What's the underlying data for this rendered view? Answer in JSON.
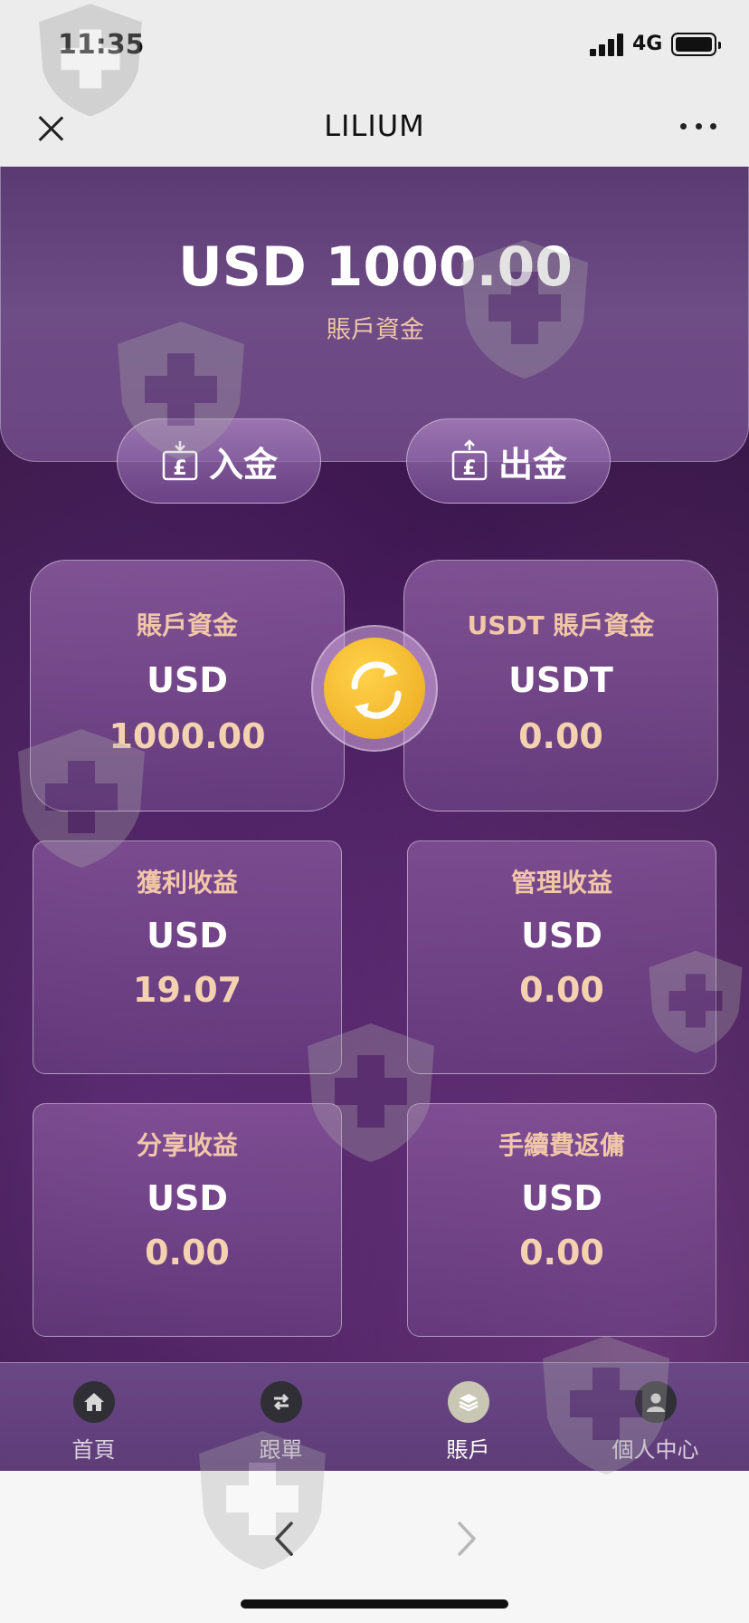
{
  "status_bar": {
    "time": "11:35",
    "network": "4G"
  },
  "nav": {
    "title": "LILIUM"
  },
  "account": {
    "balance": "USD 1000.00",
    "balance_label": "賬戶資金"
  },
  "actions": {
    "deposit_label": "入金",
    "withdraw_label": "出金"
  },
  "cards": [
    {
      "title": "賬戶資金",
      "currency": "USD",
      "value": "1000.00"
    },
    {
      "title": "USDT 賬戶資金",
      "currency": "USDT",
      "value": "0.00"
    },
    {
      "title": "獲利收益",
      "currency": "USD",
      "value": "19.07"
    },
    {
      "title": "管理收益",
      "currency": "USD",
      "value": "0.00"
    },
    {
      "title": "分享收益",
      "currency": "USD",
      "value": "0.00"
    },
    {
      "title": "手續費返傭",
      "currency": "USD",
      "value": "0.00"
    }
  ],
  "tabbar": {
    "items": [
      {
        "label": "首頁",
        "icon": "home-icon",
        "active": false
      },
      {
        "label": "跟單",
        "icon": "swap-icon",
        "active": false
      },
      {
        "label": "賬戶",
        "icon": "layers-icon",
        "active": true
      },
      {
        "label": "個人中心",
        "icon": "user-icon",
        "active": false
      }
    ]
  },
  "colors": {
    "accent_text": "#f1c7a8",
    "value_text": "#f4d2b0",
    "swap_button": "#f2b92c",
    "card_border": "#ffffff"
  }
}
